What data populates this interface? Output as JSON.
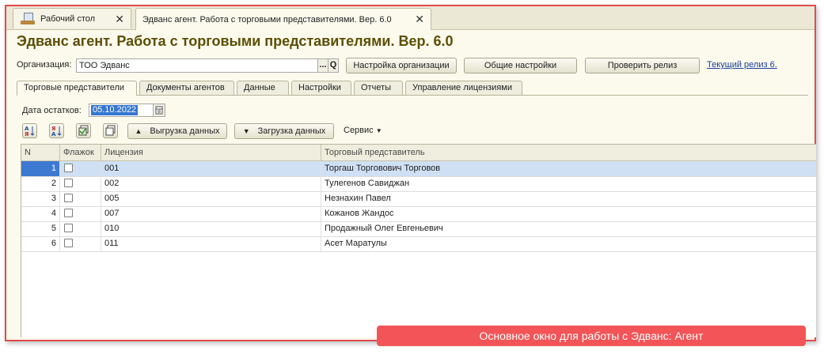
{
  "tabs": [
    {
      "label": "Рабочий стол"
    },
    {
      "label": "Эдванс агент. Работа с торговыми представителями. Вер. 6.0"
    }
  ],
  "close_glyph": "✕",
  "window_title": "Эдванс агент. Работа с торговыми представителями. Вер. 6.0",
  "organization": {
    "label": "Организация:",
    "value": "ТОО Эдванс",
    "select_label": "...",
    "search_glyph": "Q"
  },
  "buttons": {
    "org_settings": "Настройка организации",
    "general_settings": "Общие настройки",
    "check_release": "Проверить релиз",
    "current_release_link": "Текущий релиз 6."
  },
  "inner_tabs": [
    {
      "label": "Торговые представители"
    },
    {
      "label": "Документы агентов"
    },
    {
      "label": "Данные"
    },
    {
      "label": "Настройки"
    },
    {
      "label": "Отчеты"
    },
    {
      "label": "Управление лицензиями"
    }
  ],
  "date": {
    "label": "Дата остатков:",
    "value": "05.10.2022"
  },
  "toolbar": {
    "upload_label": "Выгрузка данных",
    "download_label": "Загрузка данных",
    "service_label": "Сервис",
    "sort_asc_icon": "sort-asc-icon",
    "sort_desc_icon": "sort-desc-icon",
    "check_all_icon": "check-all-icon",
    "uncheck_all_icon": "uncheck-all-icon"
  },
  "table": {
    "columns": [
      "N",
      "Флажок",
      "Лицензия",
      "Торговый представитель"
    ],
    "rows": [
      {
        "n": "1",
        "license": "001",
        "agent": "Торгаш Торговович Торговов"
      },
      {
        "n": "2",
        "license": "002",
        "agent": "Тулегенов Савиджан"
      },
      {
        "n": "3",
        "license": "005",
        "agent": "Незнахин Павел"
      },
      {
        "n": "4",
        "license": "007",
        "agent": "Кожанов Жандос"
      },
      {
        "n": "5",
        "license": "010",
        "agent": "Продажный Олег Евгеньевич"
      },
      {
        "n": "6",
        "license": "011",
        "agent": "Асет Маратулы"
      }
    ]
  },
  "caption": "Основное окно для работы с Эдванс: Агент",
  "colors": {
    "frame_border": "#e24b4b",
    "title": "#5c4e06",
    "caption_bg": "#f25457",
    "selection": "#3d79d1"
  }
}
